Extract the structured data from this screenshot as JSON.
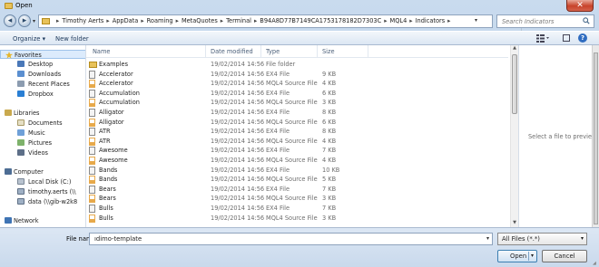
{
  "window": {
    "title": "Open",
    "close_glyph": "✕"
  },
  "address": {
    "breadcrumb": [
      "Timothy Aerts",
      "AppData",
      "Roaming",
      "MetaQuotes",
      "Terminal",
      "B94A8D77B7149CA1753178182D7303C",
      "MQL4",
      "Indicators"
    ],
    "separator": "▸",
    "search_placeholder": "Search Indicators"
  },
  "toolbar": {
    "organize_label": "Organize ▾",
    "new_folder_label": "New folder",
    "help_glyph": "?"
  },
  "sidebar": {
    "favorites": {
      "label": "Favorites",
      "items": [
        "Desktop",
        "Downloads",
        "Recent Places",
        "Dropbox"
      ]
    },
    "libraries": {
      "label": "Libraries",
      "items": [
        "Documents",
        "Music",
        "Pictures",
        "Videos"
      ]
    },
    "computer": {
      "label": "Computer",
      "items": [
        "Local Disk (C:)",
        "timothy.aerts (\\\\",
        "data (\\\\gib-w2k8"
      ]
    },
    "network": {
      "label": "Network"
    }
  },
  "columns": {
    "name": "Name",
    "date": "Date modified",
    "type": "Type",
    "size": "Size"
  },
  "files": [
    {
      "name": "Examples",
      "date": "19/02/2014 14:56",
      "type": "File folder",
      "size": "",
      "kind": "folder"
    },
    {
      "name": "Accelerator",
      "date": "19/02/2014 14:56",
      "type": "EX4 File",
      "size": "9 KB",
      "kind": "ex4"
    },
    {
      "name": "Accelerator",
      "date": "19/02/2014 14:56",
      "type": "MQL4 Source File",
      "size": "4 KB",
      "kind": "mq4"
    },
    {
      "name": "Accumulation",
      "date": "19/02/2014 14:56",
      "type": "EX4 File",
      "size": "6 KB",
      "kind": "ex4"
    },
    {
      "name": "Accumulation",
      "date": "19/02/2014 14:56",
      "type": "MQL4 Source File",
      "size": "3 KB",
      "kind": "mq4"
    },
    {
      "name": "Alligator",
      "date": "19/02/2014 14:56",
      "type": "EX4 File",
      "size": "8 KB",
      "kind": "ex4"
    },
    {
      "name": "Alligator",
      "date": "19/02/2014 14:56",
      "type": "MQL4 Source File",
      "size": "6 KB",
      "kind": "mq4"
    },
    {
      "name": "ATR",
      "date": "19/02/2014 14:56",
      "type": "EX4 File",
      "size": "8 KB",
      "kind": "ex4"
    },
    {
      "name": "ATR",
      "date": "19/02/2014 14:56",
      "type": "MQL4 Source File",
      "size": "4 KB",
      "kind": "mq4"
    },
    {
      "name": "Awesome",
      "date": "19/02/2014 14:56",
      "type": "EX4 File",
      "size": "7 KB",
      "kind": "ex4"
    },
    {
      "name": "Awesome",
      "date": "19/02/2014 14:56",
      "type": "MQL4 Source File",
      "size": "4 KB",
      "kind": "mq4"
    },
    {
      "name": "Bands",
      "date": "19/02/2014 14:56",
      "type": "EX4 File",
      "size": "10 KB",
      "kind": "ex4"
    },
    {
      "name": "Bands",
      "date": "19/02/2014 14:56",
      "type": "MQL4 Source File",
      "size": "5 KB",
      "kind": "mq4"
    },
    {
      "name": "Bears",
      "date": "19/02/2014 14:56",
      "type": "EX4 File",
      "size": "7 KB",
      "kind": "ex4"
    },
    {
      "name": "Bears",
      "date": "19/02/2014 14:56",
      "type": "MQL4 Source File",
      "size": "3 KB",
      "kind": "mq4"
    },
    {
      "name": "Bulls",
      "date": "19/02/2014 14:56",
      "type": "EX4 File",
      "size": "7 KB",
      "kind": "ex4"
    },
    {
      "name": "Bulls",
      "date": "19/02/2014 14:56",
      "type": "MQL4 Source File",
      "size": "3 KB",
      "kind": "mq4"
    }
  ],
  "preview": {
    "message": "Select a file to preview."
  },
  "bottom": {
    "file_name_label": "File name:",
    "file_name_value": "ıdimo-template",
    "filter_value": "All Files (*.*)",
    "open_label": "Open",
    "cancel_label": "Cancel"
  },
  "colors": {
    "folder": "#e8c25a",
    "ex4_icon": "#c8c8c8",
    "mq4_icon": "#e7a94a",
    "selection": "#dcebfc"
  }
}
